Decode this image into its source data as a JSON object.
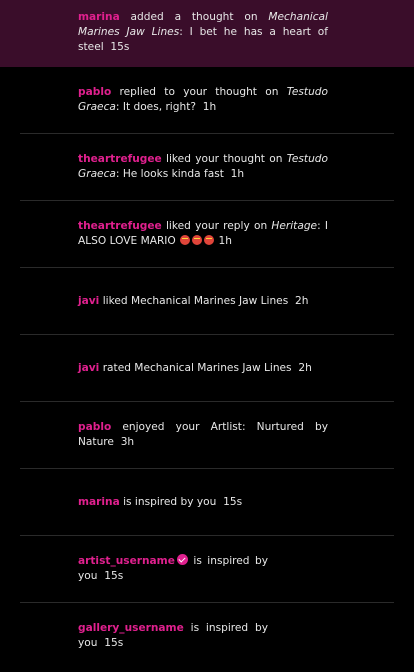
{
  "notifications": [
    {
      "user": "marina",
      "pre": " added a thought on ",
      "title": "Mechanical Marines Jaw Lines",
      "post": ": I bet he has a heart of steel",
      "time": "15s"
    },
    {
      "user": "pablo",
      "pre": " replied to your thought on ",
      "title": "Testudo Graeca",
      "post": ": It does, right?",
      "time": "1h"
    },
    {
      "user": "theartrefugee",
      "pre": " liked your thought on ",
      "title": "Testudo Graeca",
      "post": ": He looks kinda fast",
      "time": "1h"
    },
    {
      "user": "theartrefugee",
      "pre": " liked your reply on ",
      "title": "Heritage",
      "post": ": I ALSO LOVE MARIO",
      "time": "1h"
    },
    {
      "user": "javi",
      "pre": " liked Mechanical Marines Jaw Lines",
      "time": "2h"
    },
    {
      "user": "javi",
      "pre": " rated Mechanical Marines Jaw Lines",
      "time": "2h"
    },
    {
      "user": "pablo",
      "pre": " enjoyed your Artlist: Nurtured by Nature",
      "time": "3h"
    },
    {
      "user": "marina",
      "pre": " is inspired by you",
      "time": "15s"
    },
    {
      "user": "artist_username",
      "pre": " is inspired by you",
      "time": "15s"
    },
    {
      "user": "gallery_username",
      "pre": " is inspired by you",
      "time": "15s"
    }
  ],
  "icons": {
    "emoji": "star-struck-emoji-icon",
    "verified": "verified-badge-icon"
  },
  "colors": {
    "accent": "#e0208e",
    "highlight_bg": "#3a0d2a",
    "background": "#000000"
  }
}
